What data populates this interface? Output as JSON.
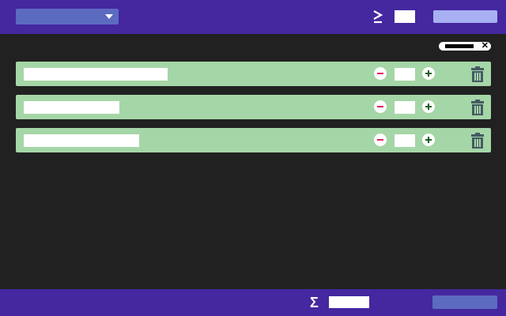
{
  "header": {
    "dropdown": {
      "selected": ""
    },
    "operator_icon": "greater-than-or-equal-icon",
    "threshold_value": "",
    "action_button_label": ""
  },
  "filter_chip": {
    "label": "",
    "close_icon": "close-icon"
  },
  "items": [
    {
      "name": "",
      "quantity": ""
    },
    {
      "name": "",
      "quantity": ""
    },
    {
      "name": "",
      "quantity": ""
    }
  ],
  "footer": {
    "sum_icon": "sigma-icon",
    "total_value": "",
    "action_button_label": ""
  },
  "colors": {
    "bar": "#4527a0",
    "background": "#212121",
    "row": "#a5d6a7",
    "decrement": "#e91e63",
    "increment": "#1b5e20",
    "primary_button": "#a7b0f2",
    "secondary_button": "#5c6bc0"
  }
}
